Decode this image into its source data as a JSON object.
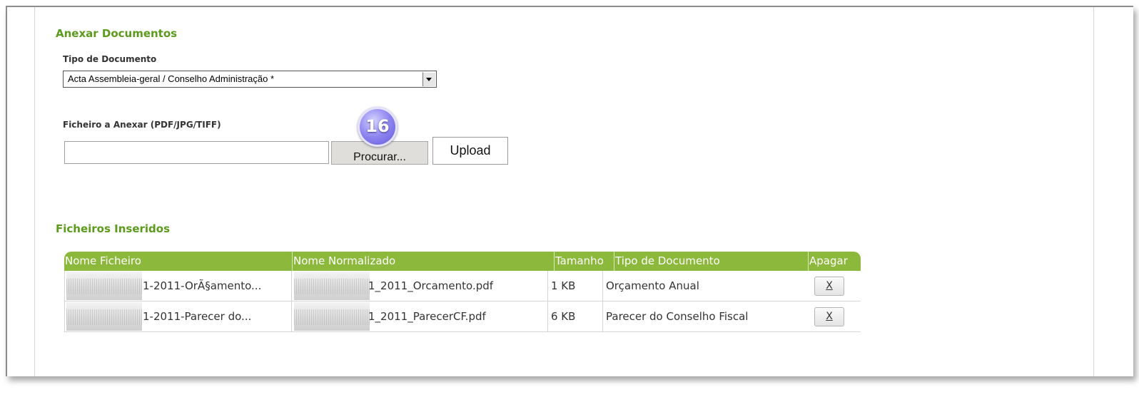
{
  "attach": {
    "title": "Anexar Documentos",
    "doc_type_label": "Tipo de Documento",
    "doc_type_value": "Acta Assembleia-geral / Conselho Administração *",
    "file_label": "Ficheiro a Anexar (PDF/JPG/TIFF)",
    "file_value": "",
    "browse_label": "Procurar...",
    "upload_label": "Upload"
  },
  "callout": {
    "number": "16"
  },
  "files": {
    "title": "Ficheiros Inseridos",
    "columns": [
      "Nome Ficheiro",
      "Nome Normalizado",
      "Tamanho",
      "Tipo de Documento",
      "Apagar"
    ],
    "rows": [
      {
        "file_name": "1-2011-OrÃ§amento...",
        "normalized_name": "1_2011_Orcamento.pdf",
        "size": "1 KB",
        "doc_type": "Orçamento Anual",
        "delete_label": "X"
      },
      {
        "file_name": "1-2011-Parecer do...",
        "normalized_name": "1_2011_ParecerCF.pdf",
        "size": "6 KB",
        "doc_type": "Parecer do Conselho Fiscal",
        "delete_label": "X"
      }
    ]
  },
  "colors": {
    "section_title": "#5c9a1b",
    "table_header": "#8cb83b"
  }
}
